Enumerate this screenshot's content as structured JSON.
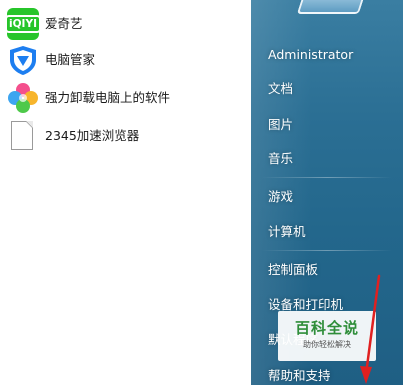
{
  "programs": [
    {
      "label": "爱奇艺",
      "icon": "iqiyi-icon",
      "icon_text": "iQIYI",
      "color": "#27c52a"
    },
    {
      "label": "电脑管家",
      "icon": "pc-manager-shield-icon",
      "color": "#1d7ef0"
    },
    {
      "label": "强力卸载电脑上的软件",
      "icon": "uninstall-clover-icon"
    },
    {
      "label": "2345加速浏览器",
      "icon": "document-icon"
    }
  ],
  "right_menu": [
    {
      "label": "Administrator"
    },
    {
      "label": "文档"
    },
    {
      "label": "图片"
    },
    {
      "label": "音乐"
    },
    {
      "label": "游戏"
    },
    {
      "label": "计算机"
    },
    {
      "label": "控制面板"
    },
    {
      "label": "设备和打印机"
    },
    {
      "label": "默认程序"
    },
    {
      "label": "帮助和支持"
    }
  ],
  "watermark": {
    "title": "百科全说",
    "subtitle": "助你轻松解决"
  },
  "colors": {
    "right_pane": "#2b6f94",
    "arrow": "#e02020",
    "watermark_green": "#2f8e3a"
  }
}
